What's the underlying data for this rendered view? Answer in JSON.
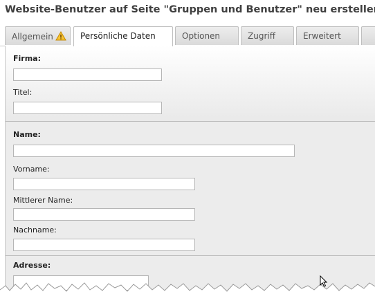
{
  "title": "Website-Benutzer auf Seite \"Gruppen und Benutzer\" neu erstellen",
  "tabs": [
    {
      "label": "Allgemein",
      "icon": "warning-icon",
      "active": false
    },
    {
      "label": "Persönliche Daten",
      "active": true
    },
    {
      "label": "Optionen",
      "active": false
    },
    {
      "label": "Zugriff",
      "active": false
    },
    {
      "label": "Erweitert",
      "active": false
    },
    {
      "label": "",
      "active": false
    }
  ],
  "form": {
    "company": {
      "label": "Firma:",
      "value": ""
    },
    "title": {
      "label": "Titel:",
      "value": ""
    },
    "name": {
      "label": "Name:",
      "value": ""
    },
    "firstname": {
      "label": "Vorname:",
      "value": ""
    },
    "middlename": {
      "label": "Mittlerer Name:",
      "value": ""
    },
    "lastname": {
      "label": "Nachname:",
      "value": ""
    },
    "address": {
      "label": "Adresse:",
      "value": ""
    }
  },
  "colors": {
    "warning": "#f0b400",
    "panel_bg": "#ececec",
    "border": "#bdbdbd"
  }
}
